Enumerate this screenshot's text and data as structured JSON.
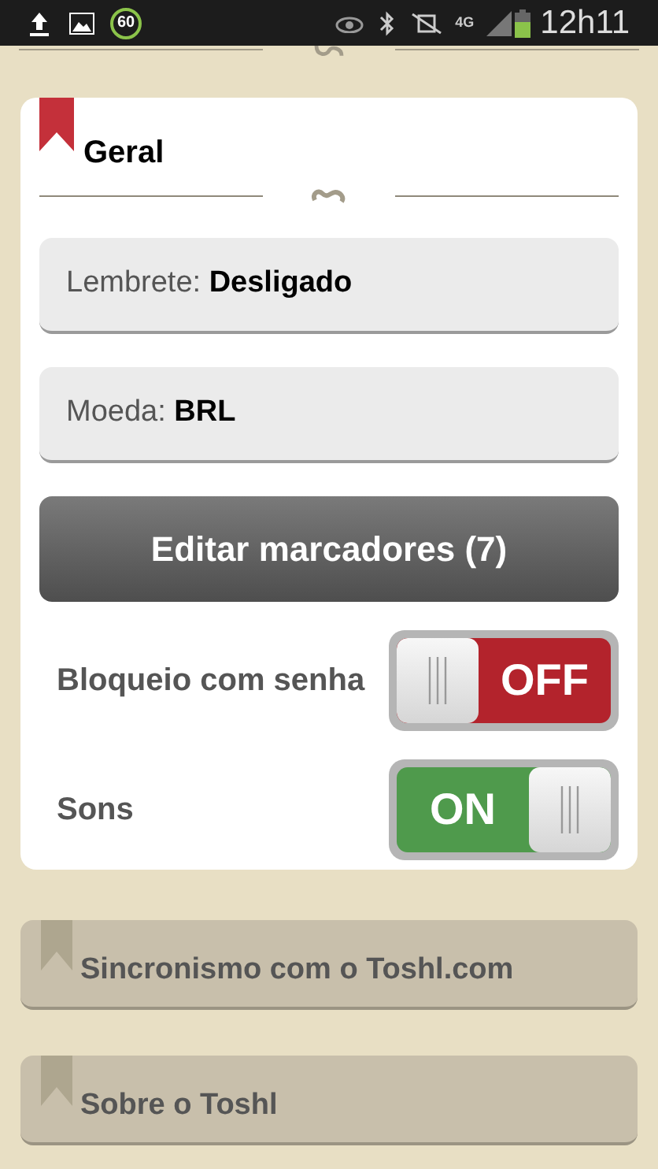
{
  "status_bar": {
    "badge": "60",
    "network": "4G",
    "time": "12h11"
  },
  "card": {
    "title": "Geral",
    "bookmarked": true
  },
  "fields": [
    {
      "label": "Lembrete:",
      "value": "Desligado"
    },
    {
      "label": "Moeda:",
      "value": "BRL"
    }
  ],
  "edit_button": "Editar marcadores (7)",
  "toggles": [
    {
      "label": "Bloqueio com senha",
      "on": false,
      "state_label": "OFF"
    },
    {
      "label": "Sons",
      "on": true,
      "state_label": "ON"
    }
  ],
  "sections": [
    {
      "title": "Sincronismo com o Toshl.com"
    },
    {
      "title": "Sobre o Toshl"
    }
  ]
}
